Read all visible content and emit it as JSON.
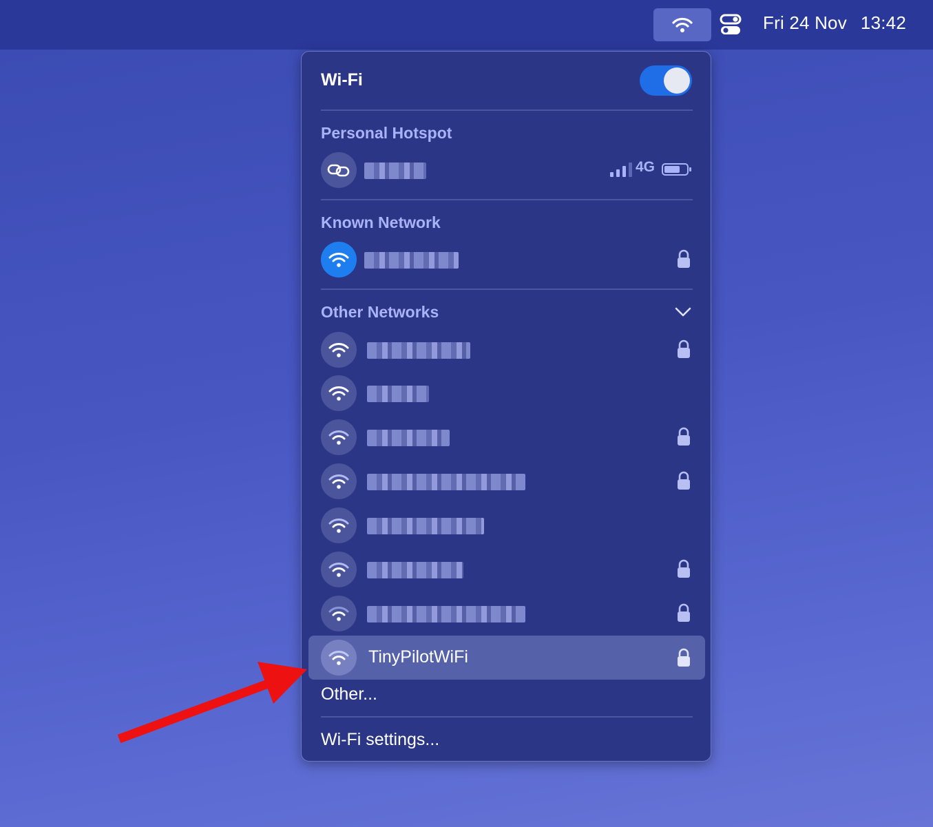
{
  "menubar": {
    "wifi_icon": "wifi-icon",
    "control_center_icon": "control-center-icon",
    "date": "Fri 24 Nov",
    "time": "13:42"
  },
  "wifi_menu": {
    "title": "Wi-Fi",
    "wifi_enabled": true,
    "sections": {
      "hotspot": "Personal Hotspot",
      "known": "Known Network",
      "other": "Other Networks"
    },
    "hotspot": {
      "name_blurred": true,
      "network_type": "4G",
      "signal_bars": 4,
      "icon": "link-icon"
    },
    "known_network": {
      "name_blurred": true,
      "secured": true,
      "connected": true
    },
    "other_networks": [
      {
        "name_blurred": true,
        "secured": true
      },
      {
        "name_blurred": true,
        "secured": false
      },
      {
        "name_blurred": true,
        "secured": true
      },
      {
        "name_blurred": true,
        "secured": true
      },
      {
        "name_blurred": true,
        "secured": false
      },
      {
        "name_blurred": true,
        "secured": true
      },
      {
        "name_blurred": true,
        "secured": true
      },
      {
        "name": "TinyPilotWiFi",
        "secured": true,
        "highlighted": true
      }
    ],
    "other_link": "Other...",
    "settings_link": "Wi-Fi settings..."
  },
  "annotation": {
    "arrow_color": "#ee1111"
  },
  "colors": {
    "accent": "#1f6ee8",
    "section_heading": "#a8b3f8",
    "panel": "#2b3686",
    "menubar": "#2a389a"
  }
}
